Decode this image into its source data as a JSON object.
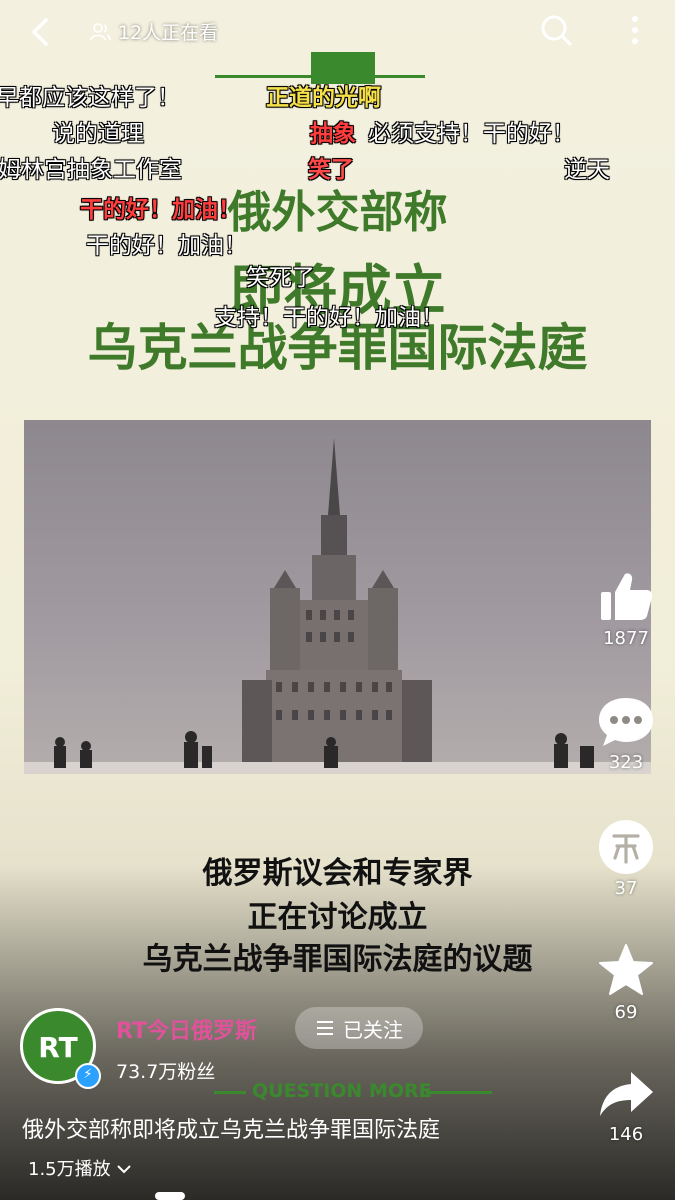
{
  "top": {
    "viewers": "12人正在看"
  },
  "headline": {
    "line1": "俄外交部称",
    "line2": "即将成立",
    "line3": "乌克兰战争罪国际法庭"
  },
  "danmaku": [
    {
      "text": "早都应该这样了！",
      "color": "white"
    },
    {
      "text": "正道的光啊",
      "color": "yellow"
    },
    {
      "text": "说的道理",
      "color": "white"
    },
    {
      "text": "抽象",
      "color": "red"
    },
    {
      "text": "必须支持！干的好！",
      "color": "white"
    },
    {
      "text": "姆林宫抽象工作室",
      "color": "white"
    },
    {
      "text": "笑了",
      "color": "red"
    },
    {
      "text": "逆天",
      "color": "white"
    },
    {
      "text": "干的好！加油！",
      "color": "red"
    },
    {
      "text": "干的好！加油！",
      "color": "white"
    },
    {
      "text": "笑死了",
      "color": "white"
    },
    {
      "text": "支持！干的好！加油！",
      "color": "white"
    }
  ],
  "subtitle": {
    "line1": "俄罗斯议会和专家界",
    "line2": "正在讨论成立",
    "line3": "乌克兰战争罪国际法庭的议题"
  },
  "rail": {
    "likes": "1877",
    "comments": "323",
    "coins": "37",
    "favorites": "69",
    "shares": "146"
  },
  "author": {
    "avatar_text": "RT",
    "name": "RT今日俄罗斯",
    "follow_label": "已关注",
    "fans": "73.7万粉丝"
  },
  "banner": "QUESTION MORE",
  "video": {
    "title": "俄外交部称即将成立乌克兰战争罪国际法庭",
    "plays": "1.5万播放"
  },
  "colors": {
    "accent_green": "#3a8a2d",
    "author_pink": "#e0529a",
    "danmaku_yellow": "#f5e04a",
    "danmaku_red": "#ff3d3d"
  }
}
